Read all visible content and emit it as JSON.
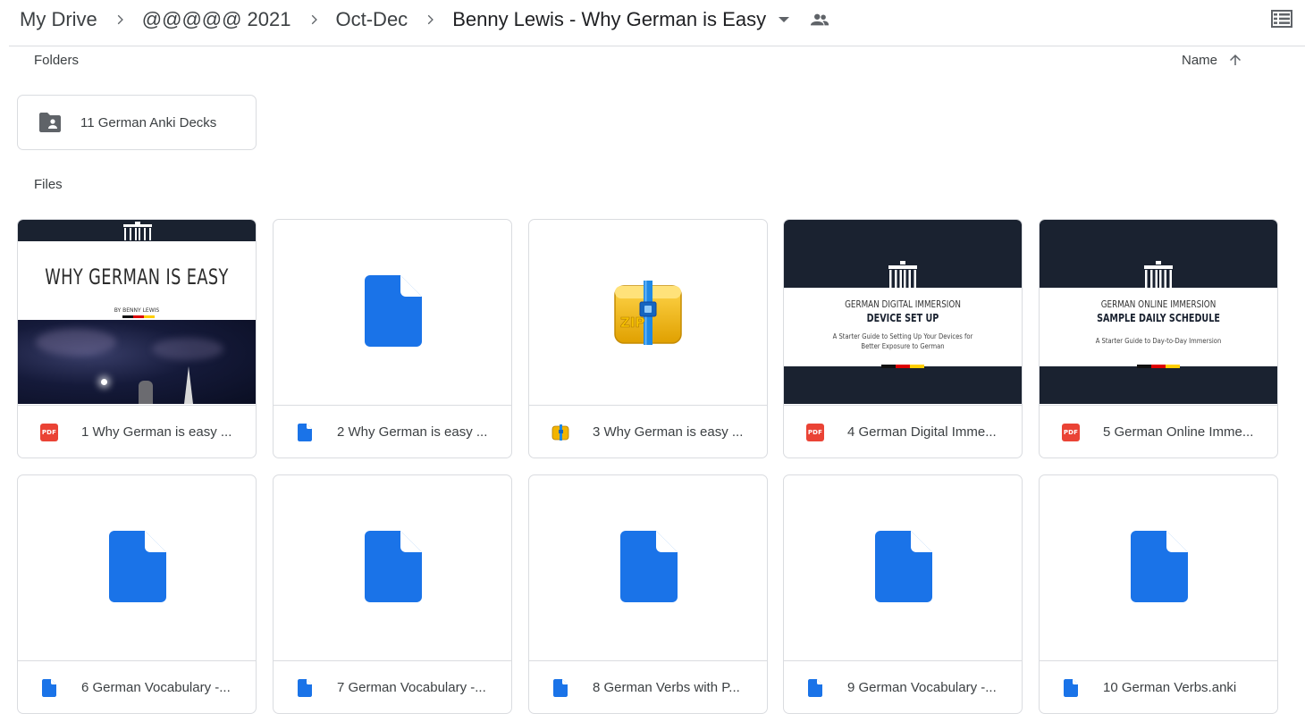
{
  "breadcrumb": {
    "items": [
      "My Drive",
      "@@@@@ 2021",
      "Oct-Dec",
      "Benny Lewis - Why German is Easy"
    ]
  },
  "sections": {
    "folders_label": "Folders",
    "files_label": "Files",
    "sort_label": "Name"
  },
  "folders": [
    {
      "name": "11 German Anki Decks",
      "icon": "shared-folder-icon"
    }
  ],
  "files": [
    {
      "name": "1 Why German is easy ...",
      "type": "pdf",
      "thumb": "cover-why-german-is-easy"
    },
    {
      "name": "2 Why German is easy ...",
      "type": "doc",
      "thumb": "generic-doc"
    },
    {
      "name": "3 Why German is easy ...",
      "type": "zip",
      "thumb": "zip-archive"
    },
    {
      "name": "4 German Digital Imme...",
      "type": "pdf",
      "thumb": "cover-device-set-up"
    },
    {
      "name": "5 German Online Imme...",
      "type": "pdf",
      "thumb": "cover-daily-schedule"
    },
    {
      "name": "6 German Vocabulary -...",
      "type": "doc",
      "thumb": "generic-doc"
    },
    {
      "name": "7 German Vocabulary -...",
      "type": "doc",
      "thumb": "generic-doc"
    },
    {
      "name": "8 German Verbs with P...",
      "type": "doc",
      "thumb": "generic-doc"
    },
    {
      "name": "9 German Vocabulary -...",
      "type": "doc",
      "thumb": "generic-doc"
    },
    {
      "name": "10 German Verbs.anki",
      "type": "doc",
      "thumb": "generic-doc"
    }
  ],
  "thumbnails": {
    "cover1": {
      "title": "WHY GERMAN IS EASY",
      "byline": "BY BENNY LEWIS"
    },
    "cover4": {
      "line1": "GERMAN DIGITAL IMMERSION",
      "line2": "DEVICE SET UP",
      "line3": "A Starter Guide to Setting Up Your Devices for",
      "line4": "Better Exposure to German"
    },
    "cover5": {
      "line1": "GERMAN ONLINE IMMERSION",
      "line2": "SAMPLE DAILY SCHEDULE",
      "line3": "A Starter Guide to Day-to-Day Immersion"
    },
    "zip_label": "ZIP"
  },
  "pdf_badge": "PDF",
  "colors": {
    "doc_blue": "#1a73e8",
    "pdf_red": "#ea4335",
    "cover_dark": "#1a2230",
    "border": "#dadce0"
  }
}
